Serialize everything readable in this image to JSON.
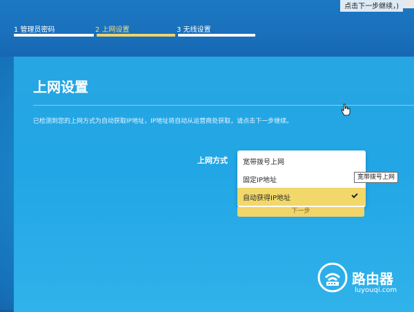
{
  "topbar": {
    "corner_text": "点击下一步继续，)"
  },
  "steps": [
    {
      "label": "1 管理员密码",
      "state": "done"
    },
    {
      "label": "2 上网设置",
      "state": "current"
    },
    {
      "label": "3 无线设置",
      "state": "pending"
    }
  ],
  "page": {
    "title": "上网设置",
    "description": "已检测到您的上网方式为自动获取IP地址，IP地址将自动从运营商处获取，请点击下一步继续。"
  },
  "form": {
    "label": "上网方式",
    "options": [
      "宽带拨号上网",
      "固定IP地址",
      "自动获得IP地址"
    ],
    "selected_index": 2,
    "next_button": "下一步"
  },
  "tooltip": {
    "text": "宽带拨号上网"
  },
  "watermark": {
    "name_cn": "路由器",
    "site": "luyouqi.com"
  },
  "colors": {
    "accent": "#f2d86a",
    "panel": "#24a7e5",
    "background": "#1670b8"
  }
}
